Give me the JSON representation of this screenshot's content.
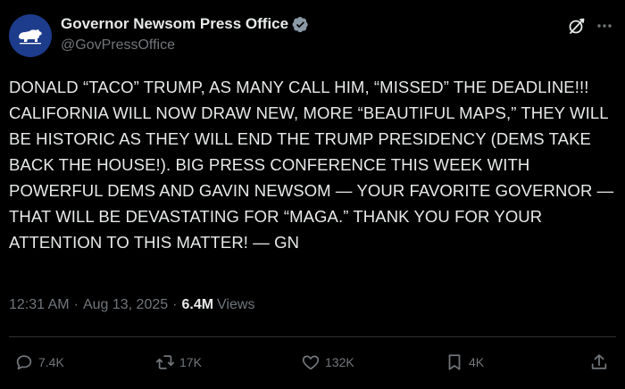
{
  "header": {
    "display_name": "Governor Newsom Press Office",
    "handle": "@GovPressOffice",
    "verified": true,
    "avatar_icon": "california-bear-icon",
    "avatar_color": "#1d3c8c",
    "verified_color": "#8b98a5"
  },
  "tweet": {
    "text": "DONALD “TACO” TRUMP,  AS MANY CALL HIM, “MISSED” THE DEADLINE!!! CALIFORNIA WILL NOW DRAW NEW, MORE “BEAUTIFUL MAPS,” THEY WILL BE HISTORIC AS THEY WILL END THE TRUMP PRESIDENCY (DEMS TAKE BACK THE HOUSE!). BIG PRESS CONFERENCE THIS WEEK WITH POWERFUL DEMS AND GAVIN NEWSOM — YOUR FAVORITE GOVERNOR — THAT WILL BE DEVASTATING FOR “MAGA.” THANK YOU FOR YOUR ATTENTION TO THIS MATTER! — GN"
  },
  "meta": {
    "time": "12:31 AM",
    "separator": "·",
    "date": "Aug 13, 2025",
    "views_count": "6.4M",
    "views_label": "Views"
  },
  "actions": {
    "replies": "7.4K",
    "reposts": "17K",
    "likes": "132K",
    "bookmarks": "4K"
  }
}
